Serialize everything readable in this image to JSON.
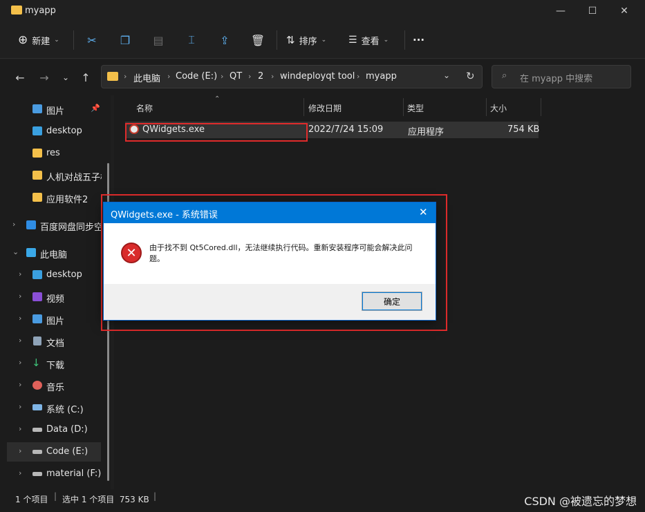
{
  "window": {
    "title": "myapp"
  },
  "toolbar": {
    "new_label": "新建",
    "sort_label": "排序",
    "view_label": "查看",
    "more": "···"
  },
  "address": {
    "crumbs": [
      "此电脑",
      "Code (E:)",
      "QT",
      "2",
      "windeployqt tool",
      "myapp"
    ],
    "search_placeholder": "在 myapp 中搜索"
  },
  "sidebar": {
    "items": [
      {
        "label": "图片",
        "icon": "pictures-icon",
        "pinned": true
      },
      {
        "label": "desktop",
        "icon": "desktop-icon"
      },
      {
        "label": "res",
        "icon": "folder-icon"
      },
      {
        "label": "人机对战五子棋",
        "icon": "folder-icon"
      },
      {
        "label": "应用软件2",
        "icon": "folder-icon"
      },
      {
        "label": "百度网盘同步空间",
        "icon": "cloud-icon",
        "expand": "›"
      },
      {
        "label": "此电脑",
        "icon": "pc-icon",
        "expand": "⌄"
      },
      {
        "label": "desktop",
        "icon": "desktop-icon",
        "expand": "›"
      },
      {
        "label": "视频",
        "icon": "video-icon",
        "expand": "›"
      },
      {
        "label": "图片",
        "icon": "pictures-icon",
        "expand": "›"
      },
      {
        "label": "文档",
        "icon": "documents-icon",
        "expand": "›"
      },
      {
        "label": "下载",
        "icon": "download-icon",
        "expand": "›"
      },
      {
        "label": "音乐",
        "icon": "music-icon",
        "expand": "›"
      },
      {
        "label": "系统 (C:)",
        "icon": "drive-c-icon",
        "expand": "›"
      },
      {
        "label": "Data (D:)",
        "icon": "drive-icon",
        "expand": "›"
      },
      {
        "label": "Code (E:)",
        "icon": "drive-icon",
        "expand": "›",
        "selected": true
      },
      {
        "label": "material (F:)",
        "icon": "drive-icon",
        "expand": "›"
      }
    ]
  },
  "columns": {
    "name": "名称",
    "modified": "修改日期",
    "type": "类型",
    "size": "大小"
  },
  "files": [
    {
      "name": "QWidgets.exe",
      "modified": "2022/7/24 15:09",
      "type": "应用程序",
      "size": "754 KB"
    }
  ],
  "status": {
    "count": "1 个项目",
    "selection": "选中 1 个项目  753 KB"
  },
  "dialog": {
    "title": "QWidgets.exe - 系统错误",
    "message": "由于找不到 Qt5Cored.dll，无法继续执行代码。重新安装程序可能会解决此问题。",
    "ok_label": "确定"
  },
  "watermark": "CSDN @被遗忘的梦想",
  "colors": {
    "accent": "#0078d7",
    "highlight": "#e02b2b",
    "folder": "#f4c04a"
  }
}
